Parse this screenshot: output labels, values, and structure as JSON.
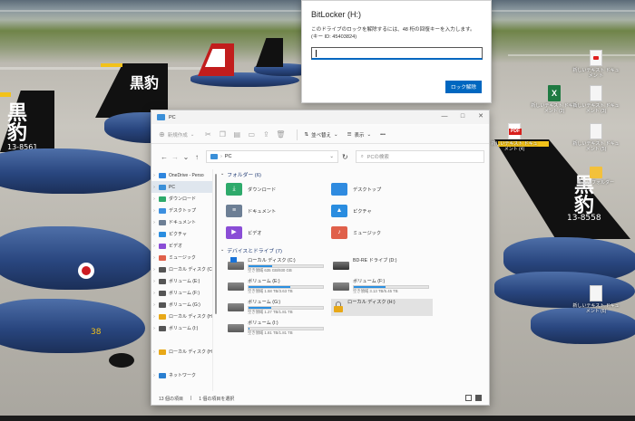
{
  "bitlocker": {
    "title": "BitLocker (H:)",
    "message_line1": "このドライブのロックを解除するには、48 桁の回復キーを入力します。",
    "message_line2": "(キー ID: 45403824)",
    "input_value": "",
    "unlock_label": "ロック解除"
  },
  "explorer": {
    "window_title": "PC",
    "win_controls": {
      "minimize": "—",
      "maximize": "□",
      "close": "✕"
    },
    "cmdbar": {
      "new_label": "新規作成",
      "sort_label": "並べ替え",
      "view_label": "表示",
      "more_label": "•••"
    },
    "address": {
      "crumb": "PC",
      "separator": "›"
    },
    "search_placeholder": "PCの検索",
    "sidebar": [
      {
        "label": "OneDrive - Perso",
        "icon": "cloud-icon",
        "color": "#2e86de",
        "selected": false
      },
      {
        "label": "PC",
        "icon": "pc-icon",
        "color": "#3a8fd8",
        "selected": true
      },
      {
        "label": "ダウンロード",
        "icon": "download-folder-icon",
        "color": "#2eaa6b",
        "selected": false
      },
      {
        "label": "デスクトップ",
        "icon": "desktop-folder-icon",
        "color": "#3c8fe0",
        "selected": false
      },
      {
        "label": "ドキュメント",
        "icon": "documents-folder-icon",
        "color": "#6d7f95",
        "selected": false
      },
      {
        "label": "ピクチャ",
        "icon": "pictures-folder-icon",
        "color": "#2a8de0",
        "selected": false
      },
      {
        "label": "ビデオ",
        "icon": "videos-folder-icon",
        "color": "#8a4dd6",
        "selected": false
      },
      {
        "label": "ミュージック",
        "icon": "music-folder-icon",
        "color": "#e0604a",
        "selected": false
      },
      {
        "label": "ローカル ディスク (C",
        "icon": "drive-icon",
        "color": "#555555",
        "selected": false
      },
      {
        "label": "ボリューム (E:)",
        "icon": "drive-icon",
        "color": "#555555",
        "selected": false
      },
      {
        "label": "ボリューム (F:)",
        "icon": "drive-icon",
        "color": "#555555",
        "selected": false
      },
      {
        "label": "ボリューム (G:)",
        "icon": "drive-icon",
        "color": "#555555",
        "selected": false
      },
      {
        "label": "ローカル ディスク (H",
        "icon": "lock-drive-icon",
        "color": "#e8a817",
        "selected": false
      },
      {
        "label": "ボリューム (I:)",
        "icon": "drive-icon",
        "color": "#555555",
        "selected": false
      },
      {
        "label": "",
        "icon": "spacer",
        "color": "",
        "selected": false
      },
      {
        "label": "ローカル ディスク (H",
        "icon": "lock-drive-icon",
        "color": "#e8a817",
        "selected": false
      },
      {
        "label": "",
        "icon": "spacer",
        "color": "",
        "selected": false
      },
      {
        "label": "ネットワーク",
        "icon": "network-icon",
        "color": "#2a7fd0",
        "selected": false
      }
    ],
    "folders_header": "フォルダー (6)",
    "folders": [
      {
        "label": "ダウンロード",
        "color": "#2eaa6b",
        "glyph": "⤓"
      },
      {
        "label": "デスクトップ",
        "color": "#2f8be0",
        "glyph": ""
      },
      {
        "label": "ドキュメント",
        "color": "#6d7f95",
        "glyph": "≡"
      },
      {
        "label": "ピクチャ",
        "color": "#2a8de0",
        "glyph": "▲"
      },
      {
        "label": "ビデオ",
        "color": "#8a4dd6",
        "glyph": "▶"
      },
      {
        "label": "ミュージック",
        "color": "#e0604a",
        "glyph": "♪"
      }
    ],
    "drives_header": "デバイスとドライブ (7)",
    "drives": [
      {
        "name": "ローカル ディスク (C:)",
        "size": "空き領域 635 GB/930 GB",
        "used_fraction": 0.32,
        "kind": "windows",
        "selected": false
      },
      {
        "name": "BD-RE ドライブ (D:)",
        "size": "",
        "used_fraction": null,
        "kind": "optical",
        "selected": false
      },
      {
        "name": "ボリューム (E:)",
        "size": "空き領域 1.58 TB/3.63 TB",
        "used_fraction": 0.56,
        "kind": "drive",
        "selected": false
      },
      {
        "name": "ボリューム (F:)",
        "size": "空き領域 3.13 TB/5.45 TB",
        "used_fraction": 0.43,
        "kind": "drive",
        "selected": false
      },
      {
        "name": "ボリューム (G:)",
        "size": "空き領域 1.27 TB/1.81 TB",
        "used_fraction": 0.3,
        "kind": "drive",
        "selected": false
      },
      {
        "name": "ローカル ディスク (H:)",
        "size": "",
        "used_fraction": null,
        "kind": "locked",
        "selected": true
      },
      {
        "name": "ボリューム (I:)",
        "size": "空き領域 1.81 TB/1.81 TB",
        "used_fraction": 0.01,
        "kind": "drive",
        "selected": false
      }
    ],
    "status": {
      "items": "13 個の項目",
      "selected": "1 個の項目を選択"
    }
  },
  "desktop_icons": [
    {
      "label": "新しいテキスト ドキュメン ト",
      "icon": "app-icon"
    },
    {
      "label": "新しいテキスト ドキュメント (2)",
      "icon": "excel-icon"
    },
    {
      "label": "新しいテキスト ドキュメント (3)",
      "icon": "file-icon"
    },
    {
      "label": "新しいテキスト ドキュメント (4)",
      "icon": "pdf-icon"
    },
    {
      "label": "新しいテキスト ドキュメント (5)",
      "icon": "file-icon"
    },
    {
      "label": "新しいフォルダー",
      "icon": "folder-icon"
    },
    {
      "label": "新しいテキスト ドキュメント (6)",
      "icon": "file-icon"
    }
  ],
  "wallpaper": {
    "tail_kanji": "黒豹",
    "tail_number_left": "13-8561",
    "tail_number_right": "13-8558",
    "nose_number": "38"
  }
}
